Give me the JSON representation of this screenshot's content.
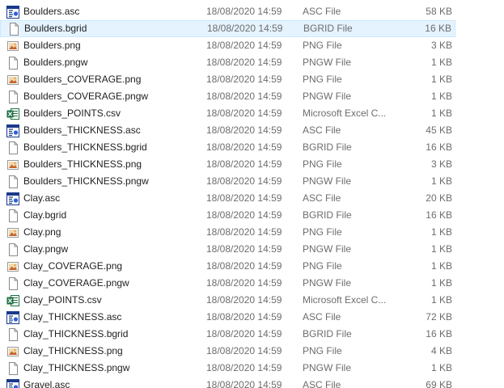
{
  "files": [
    {
      "name": "Boulders.asc",
      "date": "18/08/2020 14:59",
      "type": "ASC File",
      "size": "58 KB",
      "icon": "asc-icon"
    },
    {
      "name": "Boulders.bgrid",
      "date": "18/08/2020 14:59",
      "type": "BGRID File",
      "size": "16 KB",
      "icon": "blank-file-icon",
      "selected": true
    },
    {
      "name": "Boulders.png",
      "date": "18/08/2020 14:59",
      "type": "PNG File",
      "size": "3 KB",
      "icon": "png-icon"
    },
    {
      "name": "Boulders.pngw",
      "date": "18/08/2020 14:59",
      "type": "PNGW File",
      "size": "1 KB",
      "icon": "blank-file-icon"
    },
    {
      "name": "Boulders_COVERAGE.png",
      "date": "18/08/2020 14:59",
      "type": "PNG File",
      "size": "1 KB",
      "icon": "png-icon"
    },
    {
      "name": "Boulders_COVERAGE.pngw",
      "date": "18/08/2020 14:59",
      "type": "PNGW File",
      "size": "1 KB",
      "icon": "blank-file-icon"
    },
    {
      "name": "Boulders_POINTS.csv",
      "date": "18/08/2020 14:59",
      "type": "Microsoft Excel C...",
      "size": "1 KB",
      "icon": "excel-icon"
    },
    {
      "name": "Boulders_THICKNESS.asc",
      "date": "18/08/2020 14:59",
      "type": "ASC File",
      "size": "45 KB",
      "icon": "asc-icon"
    },
    {
      "name": "Boulders_THICKNESS.bgrid",
      "date": "18/08/2020 14:59",
      "type": "BGRID File",
      "size": "16 KB",
      "icon": "blank-file-icon"
    },
    {
      "name": "Boulders_THICKNESS.png",
      "date": "18/08/2020 14:59",
      "type": "PNG File",
      "size": "3 KB",
      "icon": "png-icon"
    },
    {
      "name": "Boulders_THICKNESS.pngw",
      "date": "18/08/2020 14:59",
      "type": "PNGW File",
      "size": "1 KB",
      "icon": "blank-file-icon"
    },
    {
      "name": "Clay.asc",
      "date": "18/08/2020 14:59",
      "type": "ASC File",
      "size": "20 KB",
      "icon": "asc-icon"
    },
    {
      "name": "Clay.bgrid",
      "date": "18/08/2020 14:59",
      "type": "BGRID File",
      "size": "16 KB",
      "icon": "blank-file-icon"
    },
    {
      "name": "Clay.png",
      "date": "18/08/2020 14:59",
      "type": "PNG File",
      "size": "1 KB",
      "icon": "png-icon"
    },
    {
      "name": "Clay.pngw",
      "date": "18/08/2020 14:59",
      "type": "PNGW File",
      "size": "1 KB",
      "icon": "blank-file-icon"
    },
    {
      "name": "Clay_COVERAGE.png",
      "date": "18/08/2020 14:59",
      "type": "PNG File",
      "size": "1 KB",
      "icon": "png-icon"
    },
    {
      "name": "Clay_COVERAGE.pngw",
      "date": "18/08/2020 14:59",
      "type": "PNGW File",
      "size": "1 KB",
      "icon": "blank-file-icon"
    },
    {
      "name": "Clay_POINTS.csv",
      "date": "18/08/2020 14:59",
      "type": "Microsoft Excel C...",
      "size": "1 KB",
      "icon": "excel-icon"
    },
    {
      "name": "Clay_THICKNESS.asc",
      "date": "18/08/2020 14:59",
      "type": "ASC File",
      "size": "72 KB",
      "icon": "asc-icon"
    },
    {
      "name": "Clay_THICKNESS.bgrid",
      "date": "18/08/2020 14:59",
      "type": "BGRID File",
      "size": "16 KB",
      "icon": "blank-file-icon"
    },
    {
      "name": "Clay_THICKNESS.png",
      "date": "18/08/2020 14:59",
      "type": "PNG File",
      "size": "4 KB",
      "icon": "png-icon"
    },
    {
      "name": "Clay_THICKNESS.pngw",
      "date": "18/08/2020 14:59",
      "type": "PNGW File",
      "size": "1 KB",
      "icon": "blank-file-icon"
    },
    {
      "name": "Gravel.asc",
      "date": "18/08/2020 14:59",
      "type": "ASC File",
      "size": "69 KB",
      "icon": "asc-icon"
    }
  ],
  "colors": {
    "selection_bg": "#e5f3ff",
    "selection_border": "#cce8ff",
    "secondary_text": "#6d6d6d",
    "excel_green": "#1d6f42",
    "asc_blue": "#1a3a8a"
  }
}
